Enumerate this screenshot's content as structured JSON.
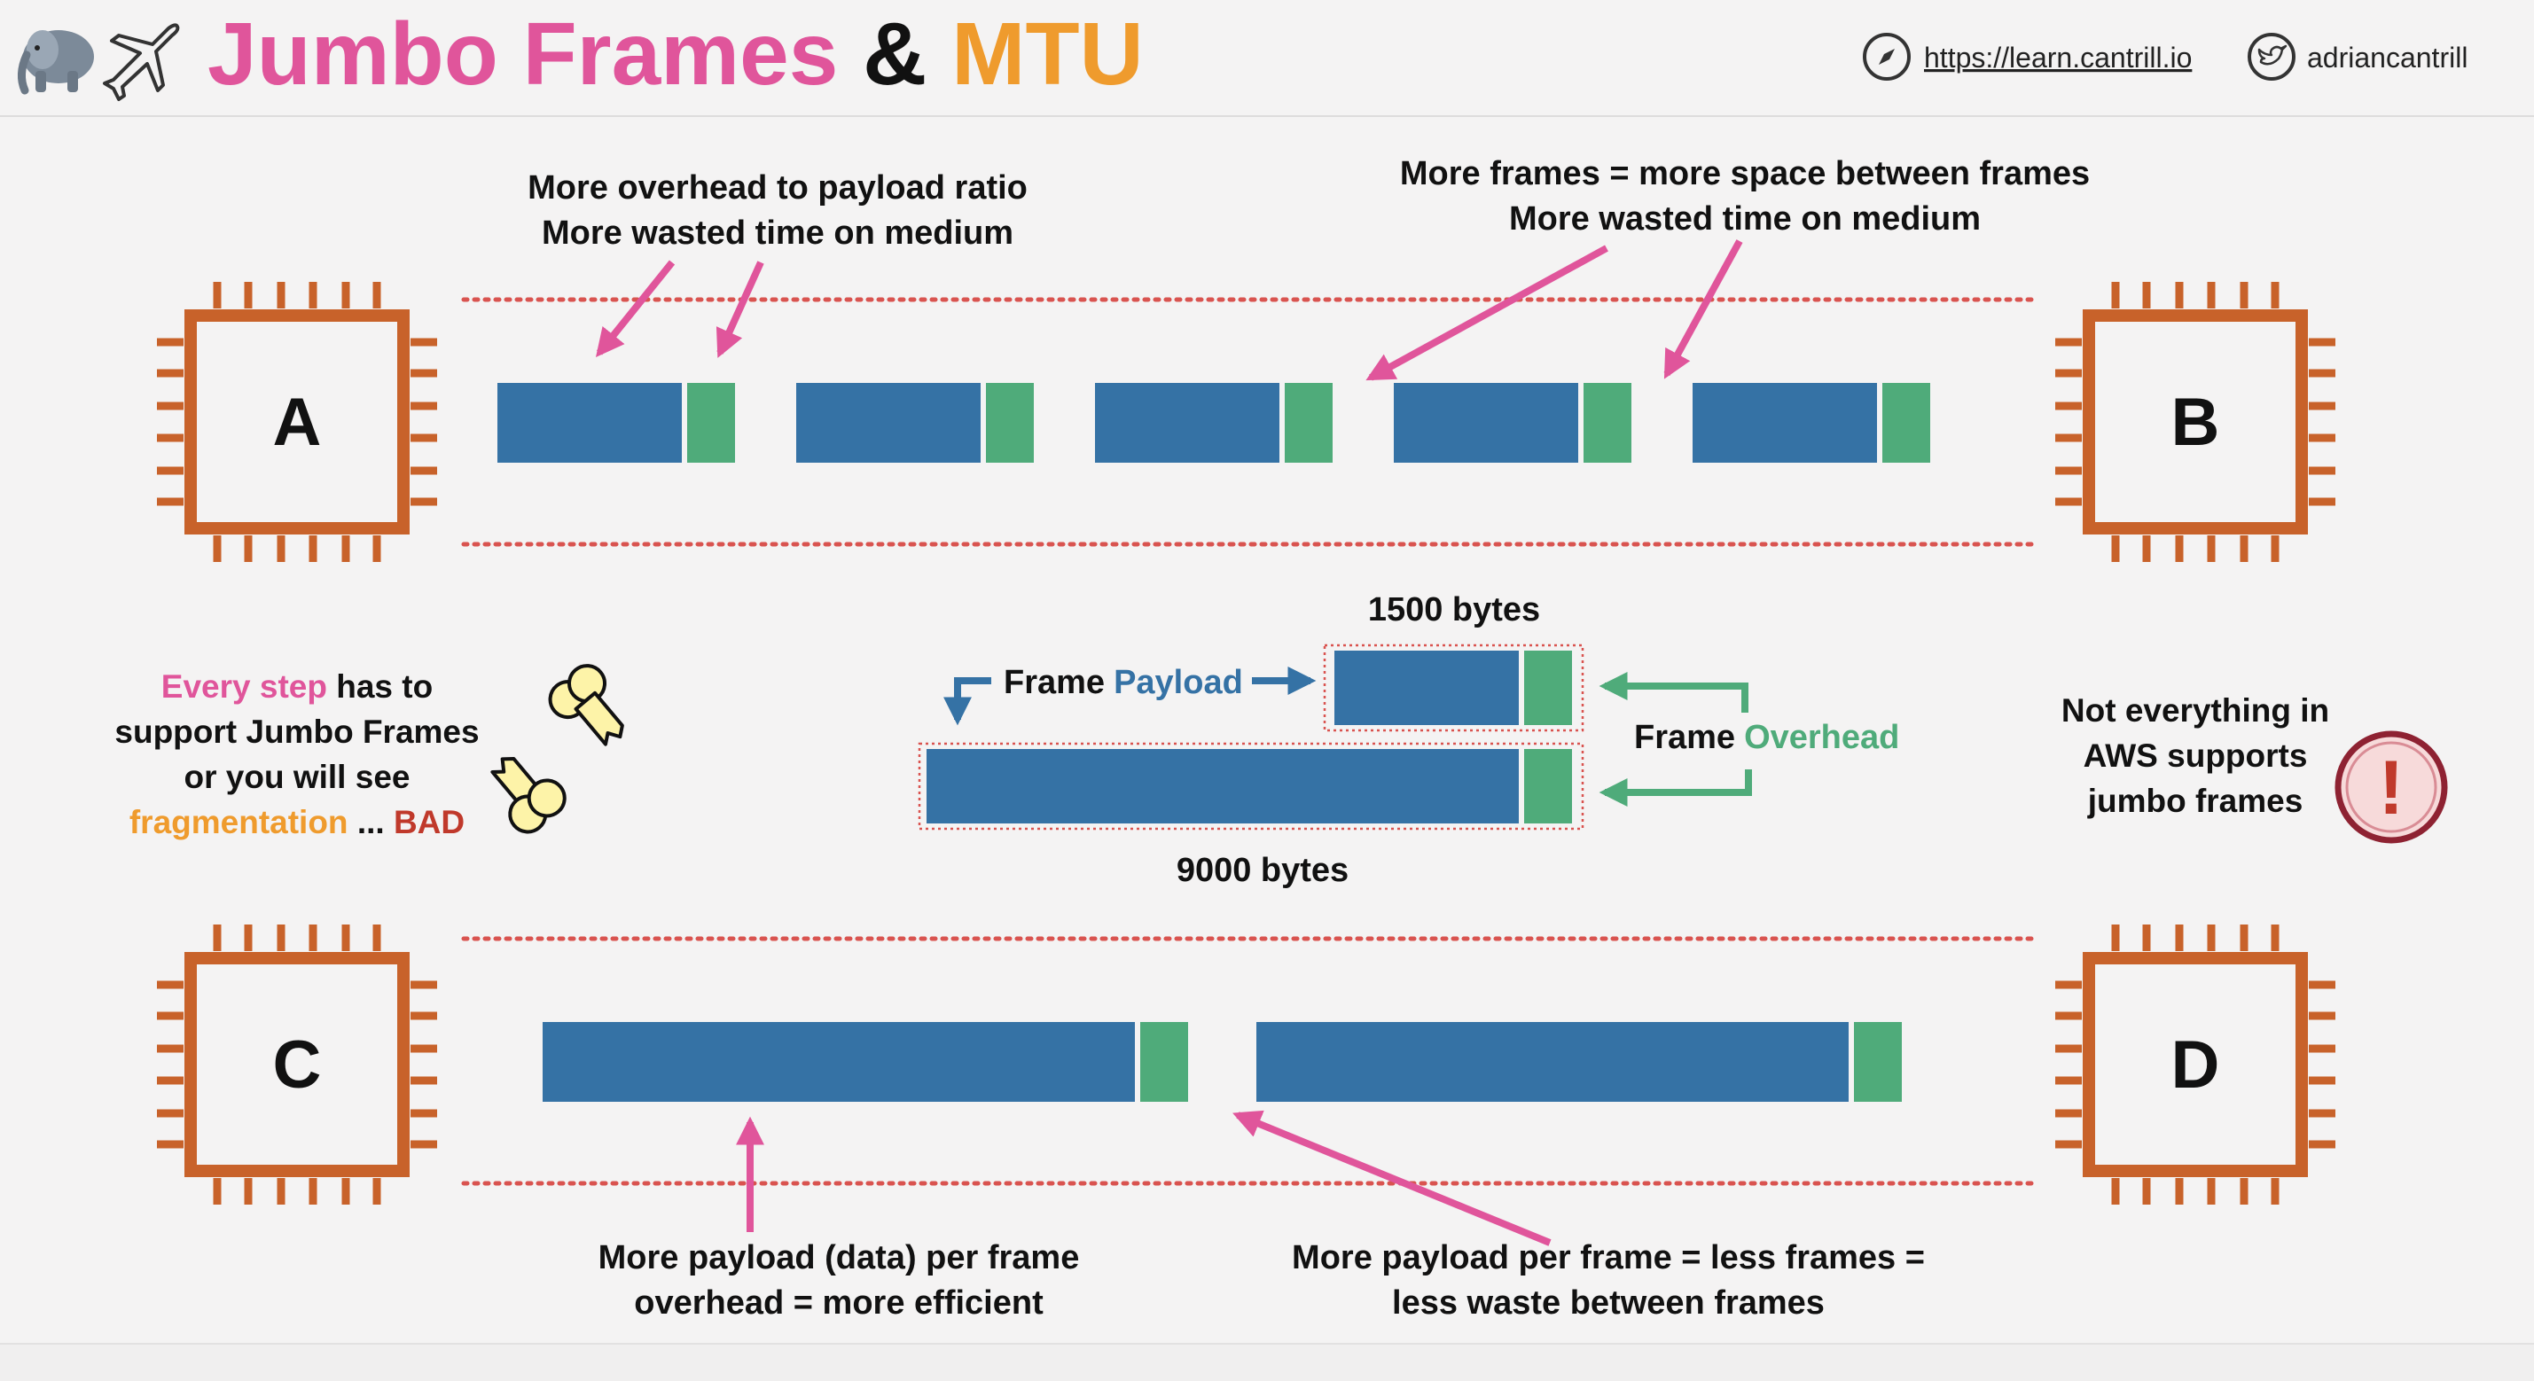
{
  "header": {
    "title_part1": "Jumbo Frames",
    "title_amp": "&",
    "title_part2": "MTU",
    "link_url": "https://learn.cantrill.io",
    "twitter_handle": "adriancantrill",
    "icons": [
      "elephant-icon",
      "airplane-icon",
      "compass-icon",
      "twitter-bird-icon"
    ]
  },
  "chips": {
    "a": "A",
    "b": "B",
    "c": "C",
    "d": "D"
  },
  "annotations": {
    "top_left_line1": "More overhead to payload ratio",
    "top_left_line2": "More wasted time on medium",
    "top_right_line1": "More frames = more space between frames",
    "top_right_line2": "More wasted time on medium",
    "bottom_left_line1": "More payload (data) per frame",
    "bottom_left_line2": "overhead = more efficient",
    "bottom_right_line1": "More payload per frame = less frames =",
    "bottom_right_line2": "less waste between frames"
  },
  "middle": {
    "frame_1500_label": "1500 bytes",
    "frame_9000_label": "9000 bytes",
    "payload_prefix": "Frame",
    "payload_word": "Payload",
    "overhead_prefix": "Frame",
    "overhead_word": "Overhead"
  },
  "left_note": {
    "l1_highlight": "Every step",
    "l1_rest": " has to",
    "l2": "support Jumbo Frames",
    "l3": "or you will see",
    "l4_highlight": "fragmentation",
    "l4_mid": " ... ",
    "l4_bad": "BAD"
  },
  "right_note": {
    "l1": "Not everything in",
    "l2": "AWS supports",
    "l3": "jumbo frames",
    "alert_symbol": "!"
  },
  "colors": {
    "pink": "#e0559b",
    "orange": "#ef9b2d",
    "payload_blue": "#3572a5",
    "overhead_green": "#4fab7a",
    "chip_brown": "#c8622a",
    "bad_red": "#c0392b",
    "dotted_red": "#d9534f"
  }
}
